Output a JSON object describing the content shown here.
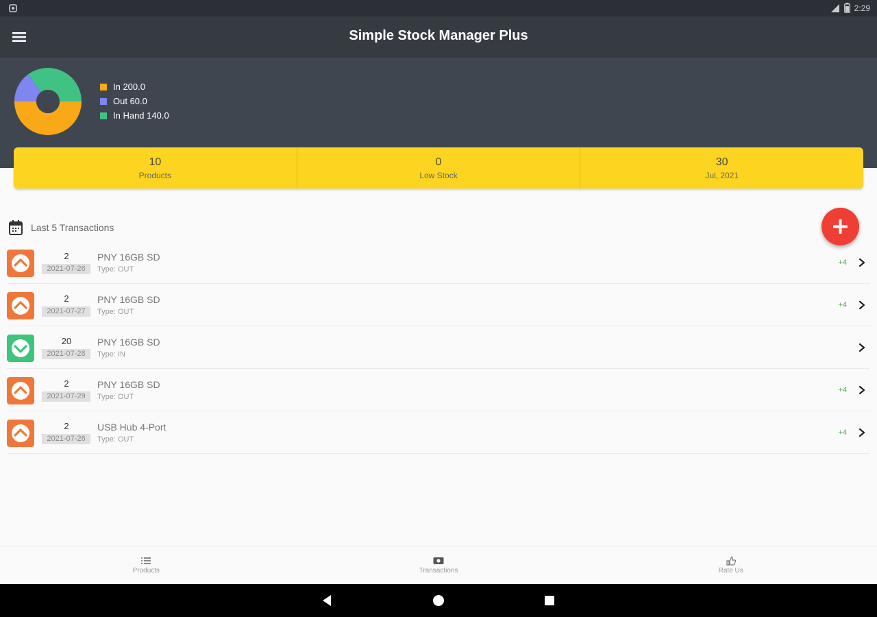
{
  "status_bar": {
    "time": "2:29",
    "signal_icon": "signal-icon",
    "battery_icon": "battery-icon"
  },
  "app": {
    "title": "Simple Stock Manager Plus"
  },
  "summary_chart": {
    "chart_data": {
      "type": "pie",
      "donut": true,
      "slices": [
        {
          "label": "In",
          "value": 200.0,
          "color": "#f9a918"
        },
        {
          "label": "Out",
          "value": 60.0,
          "color": "#7f86f0"
        },
        {
          "label": "In Hand",
          "value": 140.0,
          "color": "#3fc283"
        }
      ]
    },
    "legend": [
      {
        "text": "In 200.0",
        "color": "#f9a918"
      },
      {
        "text": "Out 60.0",
        "color": "#7f86f0"
      },
      {
        "text": "In Hand 140.0",
        "color": "#3fc283"
      }
    ]
  },
  "stats": [
    {
      "value": "10",
      "label": "Products"
    },
    {
      "value": "0",
      "label": "Low Stock"
    },
    {
      "value": "30",
      "label": "Jul, 2021"
    }
  ],
  "transactions_section": {
    "title": "Last 5 Transactions",
    "icon": "calendar-icon"
  },
  "transactions": [
    {
      "qty": "2",
      "date": "2021-07-26",
      "name": "PNY 16GB SD",
      "type": "Type: OUT",
      "change": "+4",
      "direction": "out"
    },
    {
      "qty": "2",
      "date": "2021-07-27",
      "name": "PNY 16GB SD",
      "type": "Type: OUT",
      "change": "+4",
      "direction": "out"
    },
    {
      "qty": "20",
      "date": "2021-07-28",
      "name": "PNY 16GB SD",
      "type": "Type: IN",
      "change": "",
      "direction": "in"
    },
    {
      "qty": "2",
      "date": "2021-07-29",
      "name": "PNY 16GB SD",
      "type": "Type: OUT",
      "change": "+4",
      "direction": "out"
    },
    {
      "qty": "2",
      "date": "2021-07-26",
      "name": "USB Hub 4-Port",
      "type": "Type: OUT",
      "change": "+4",
      "direction": "out"
    }
  ],
  "bottom_nav": [
    {
      "label": "Products",
      "icon": "list-icon"
    },
    {
      "label": "Transactions",
      "icon": "ticket-icon"
    },
    {
      "label": "Rate Us",
      "icon": "thumbs-up-icon"
    }
  ],
  "colors": {
    "out": "#f0773a",
    "in": "#3ec47c",
    "accent_yellow": "#fdd521",
    "fab": "#ef3f35",
    "app_bar": "#363b42",
    "header": "#40464f"
  }
}
